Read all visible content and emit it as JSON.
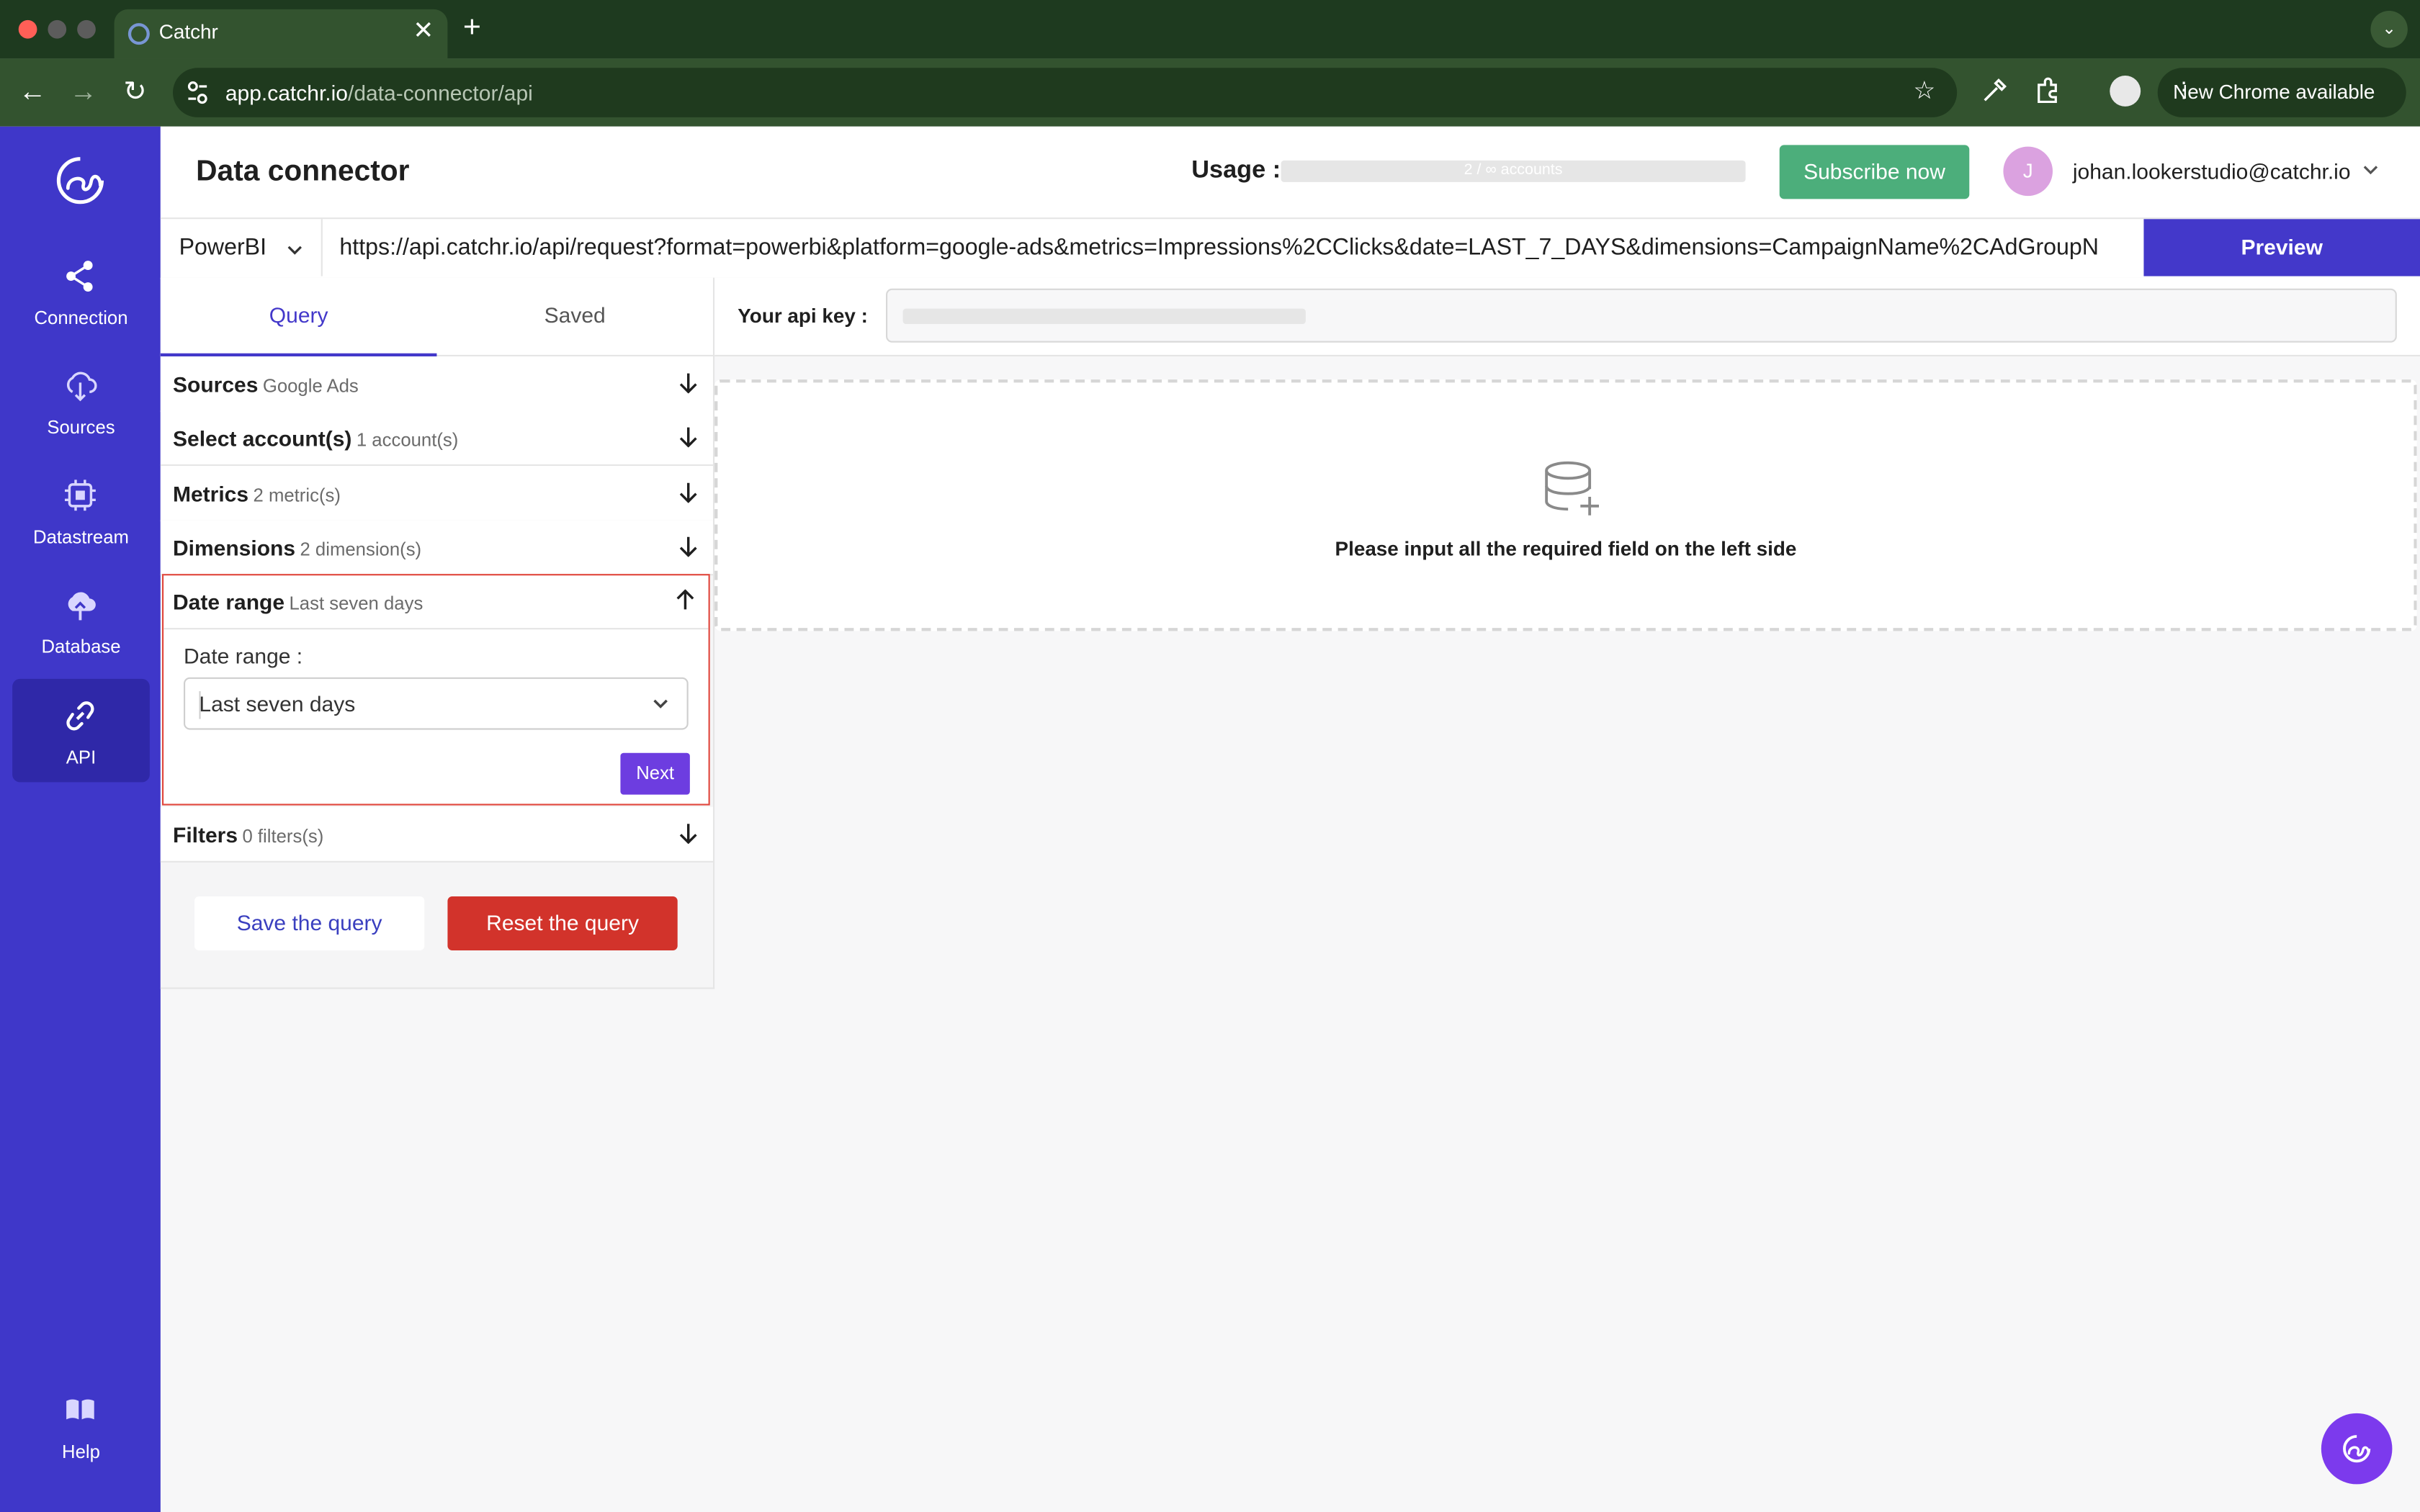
{
  "browser": {
    "tab_title": "Catchr",
    "tab_close": "✕",
    "new_tab": "+",
    "url_host": "app.catchr.io",
    "url_path": "/data-connector/api",
    "update_label": "New Chrome available"
  },
  "sidebar": {
    "items": [
      {
        "label": "Connection",
        "icon": "share-icon"
      },
      {
        "label": "Sources",
        "icon": "cloud-download-icon"
      },
      {
        "label": "Datastream",
        "icon": "chip-icon"
      },
      {
        "label": "Database",
        "icon": "cloud-upload-icon"
      },
      {
        "label": "API",
        "icon": "link-icon",
        "active": true
      },
      {
        "label": "Help",
        "icon": "book-icon"
      }
    ]
  },
  "header": {
    "title": "Data connector",
    "usage_label": "Usage :",
    "usage_value": "2 / ∞ accounts",
    "subscribe_label": "Subscribe now",
    "avatar_initial": "J",
    "user_email": "johan.lookerstudio@catchr.io"
  },
  "request": {
    "format": "PowerBI",
    "url": "https://api.catchr.io/api/request?format=powerbi&platform=google-ads&metrics=Impressions%2CClicks&date=LAST_7_DAYS&dimensions=CampaignName%2CAdGroupN",
    "preview_label": "Preview"
  },
  "query_panel": {
    "tabs": [
      "Query",
      "Saved"
    ],
    "sections": [
      {
        "title": "Sources",
        "subtitle": "Google Ads"
      },
      {
        "title": "Select account(s)",
        "subtitle": "1 account(s)"
      },
      {
        "title": "Metrics",
        "subtitle": "2 metric(s)"
      },
      {
        "title": "Dimensions",
        "subtitle": "2 dimension(s)"
      },
      {
        "title": "Date range",
        "subtitle": "Last seven days"
      },
      {
        "title": "Filters",
        "subtitle": "0 filters(s)"
      }
    ],
    "date_range": {
      "field_label": "Date range :",
      "selected": "Last seven days",
      "next_label": "Next"
    },
    "save_label": "Save the query",
    "reset_label": "Reset the query"
  },
  "api_key": {
    "label": "Your api key :"
  },
  "empty_state": {
    "message": "Please input all the required field on the left side"
  },
  "colors": {
    "sidebar": "#3f37c9",
    "accent": "#4338ca",
    "subscribe": "#4cae7b",
    "reset": "#d2332b",
    "highlight": "#e0483e"
  }
}
